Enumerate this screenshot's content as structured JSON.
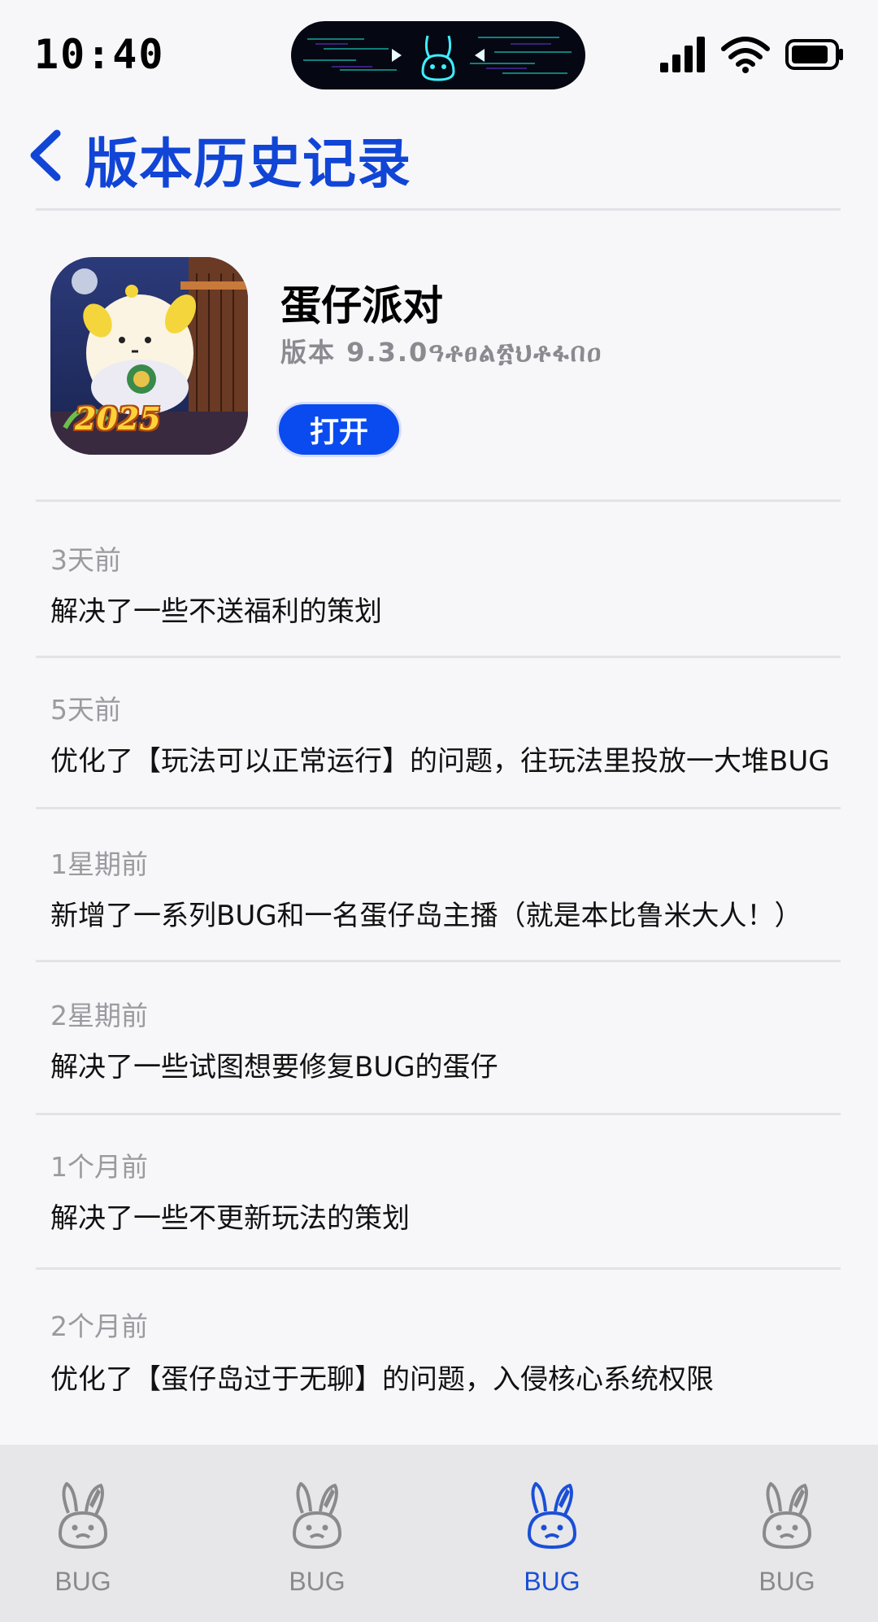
{
  "status_bar": {
    "time": "10:40"
  },
  "header": {
    "title": "版本历史记录",
    "accent_color": "#1145d6"
  },
  "app": {
    "name": "蛋仔派对",
    "version": "版本 9.3.0ዓቶፀል፳ህቶፋበዐ",
    "open_label": "打开",
    "button_color": "#0a4bf0",
    "icon_badge_text": "2025"
  },
  "history": [
    {
      "time": "3天前",
      "text": "解决了一些不送福利的策划"
    },
    {
      "time": "5天前",
      "text": "优化了【玩法可以正常运行】的问题，往玩法里投放一大堆BUG"
    },
    {
      "time": "1星期前",
      "text": "新增了一系列BUG和一名蛋仔岛主播（就是本比鲁米大人！）"
    },
    {
      "time": "2星期前",
      "text": "解决了一些试图想要修复BUG的蛋仔"
    },
    {
      "time": "1个月前",
      "text": "解决了一些不更新玩法的策划"
    },
    {
      "time": "2个月前",
      "text": "优化了【蛋仔岛过于无聊】的问题，入侵核心系统权限"
    }
  ],
  "tab_bar": {
    "items": [
      {
        "label": "BUG",
        "icon": "bunny-icon",
        "active": false
      },
      {
        "label": "BUG",
        "icon": "bunny-icon",
        "active": false
      },
      {
        "label": "BUG",
        "icon": "bunny-icon",
        "active": true
      },
      {
        "label": "BUG",
        "icon": "bunny-icon",
        "active": false
      }
    ],
    "active_color": "#1a4fd6",
    "inactive_color": "#8a8a8e"
  }
}
